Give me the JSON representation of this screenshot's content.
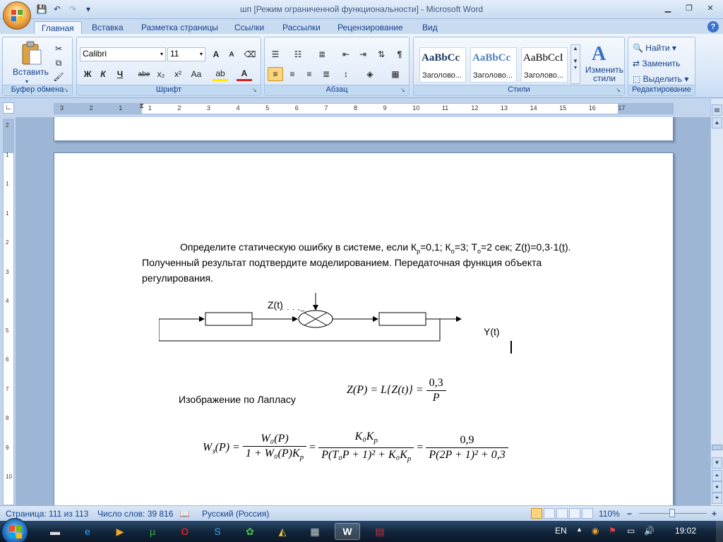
{
  "window": {
    "title": "шп [Режим ограниченной функциональности] - Microsoft Word",
    "minimize": "▁",
    "maximize": "❐",
    "close": "✕"
  },
  "qat": {
    "save_icon": "💾",
    "undo_icon": "↶",
    "redo_icon": "↷",
    "customize_icon": "▾"
  },
  "tabs": [
    "Главная",
    "Вставка",
    "Разметка страницы",
    "Ссылки",
    "Рассылки",
    "Рецензирование",
    "Вид"
  ],
  "help": "?",
  "ribbon": {
    "clipboard": {
      "title": "Буфер обмена",
      "paste_label": "Вставить"
    },
    "font": {
      "title": "Шрифт",
      "font_name": "Calibri",
      "font_size": "11",
      "bold": "Ж",
      "italic": "К",
      "underline": "Ч",
      "strike": "abe",
      "subscript": "x₂",
      "superscript": "x²",
      "case": "Aa",
      "grow": "A",
      "shrink": "A"
    },
    "paragraph": {
      "title": "Абзац",
      "pilcrow": "¶"
    },
    "styles": {
      "title": "Стили",
      "cards": [
        {
          "sample": "AaBbCc",
          "caption": "Заголово...",
          "color": "#17365d"
        },
        {
          "sample": "AaBbCc",
          "caption": "Заголово...",
          "color": "#4f81bd"
        },
        {
          "sample": "AaBbCcI",
          "caption": "Заголово...",
          "color": "#000000"
        }
      ],
      "change_label": "Изменить стили"
    },
    "editing": {
      "title": "Редактирование",
      "find": "Найти",
      "replace": "Заменить",
      "select": "Выделить"
    }
  },
  "ruler": {
    "h_ticks": [
      "3",
      "2",
      "1",
      "1",
      "2",
      "3",
      "4",
      "5",
      "6",
      "7",
      "8",
      "9",
      "10",
      "11",
      "12",
      "13",
      "14",
      "15",
      "16",
      "17"
    ],
    "v_ticks": [
      "2",
      "1",
      "1",
      "1",
      "2",
      "3",
      "4",
      "5",
      "6",
      "7",
      "8",
      "9",
      "10"
    ]
  },
  "document": {
    "p1_line1": "Определите статическую ошибку в системе, если  К",
    "p1_kp_sub": "р",
    "p1_kp_val": "=0,1; К",
    "p1_ko_sub": "о",
    "p1_ko_val": "=3; Т",
    "p1_to_sub": "о",
    "p1_to_val": "=2 сек; Z(",
    "p1_t1": "t",
    "p1_tail1": ")=0,3·1(",
    "p1_t2": "t",
    "p1_tail2": ").",
    "p1_line2": "Полученный результат подтвердите моделированием. Передаточная функция объекта",
    "p1_line3": "регулирования.",
    "diagram": {
      "z_label": "Z(t)",
      "y_label": "Y(t)",
      "block2_text": ". . .  ,_"
    },
    "laplace_label": "Изображение по Лапласу",
    "eq1": {
      "lhs": "Z(P) = L{Z(t)} =",
      "num": "0,3",
      "den": "P"
    },
    "eq2": {
      "lhs_W": "W",
      "lhs_sub": "з",
      "lhs_rest": "(P) =",
      "f1_num": "W₀(P)",
      "f1_den": "1 + W₀(P)K",
      "f1_den_sub": "p",
      "eq_a": "=",
      "f2_num": "K₀K",
      "f2_num_sub": "p",
      "f2_den": "P(T₀P + 1)² + K₀K",
      "f2_den_sub": "p",
      "eq_b": "=",
      "f3_num": "0,9",
      "f3_den": "P(2P + 1)²  + 0,3"
    }
  },
  "status": {
    "page": "Страница: 111 из 113",
    "words": "Число слов: 39 816",
    "language": "Русский (Россия)",
    "zoom": "110%",
    "zoom_out": "−",
    "zoom_in": "+"
  },
  "taskbar": {
    "lang": "EN",
    "time": "19:02"
  }
}
